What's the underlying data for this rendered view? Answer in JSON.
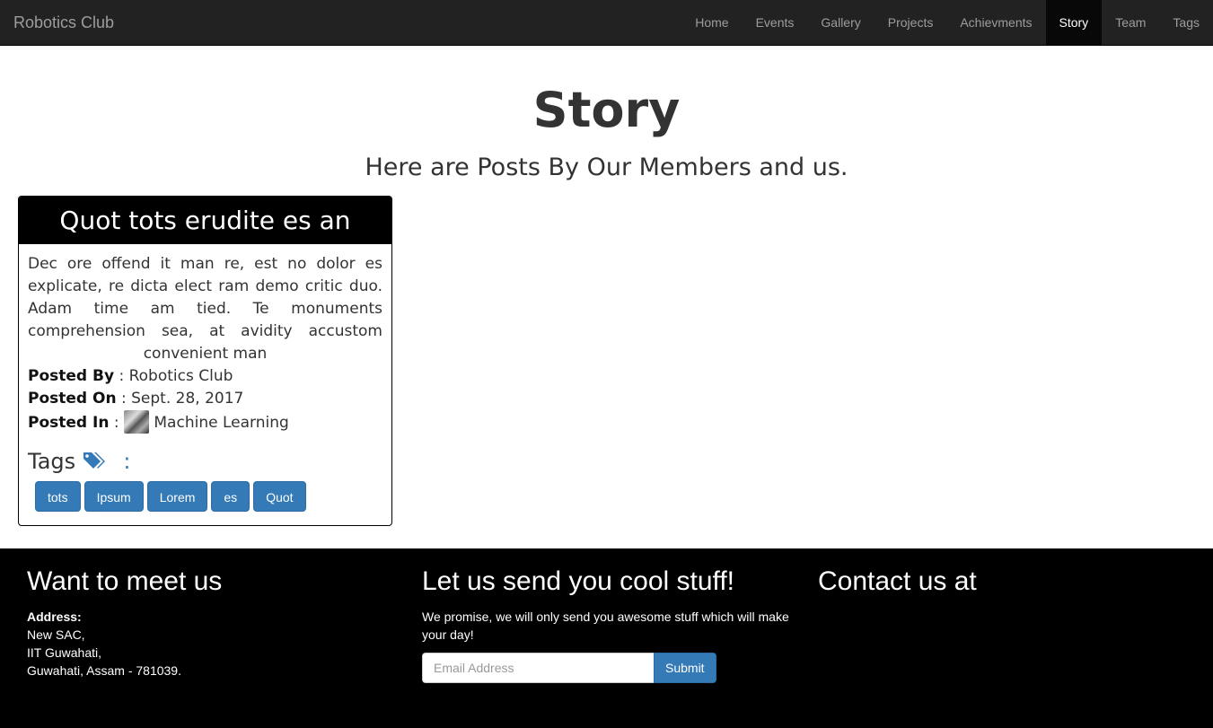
{
  "navbar": {
    "brand": "Robotics Club",
    "items": [
      {
        "label": "Home",
        "active": false
      },
      {
        "label": "Events",
        "active": false
      },
      {
        "label": "Gallery",
        "active": false
      },
      {
        "label": "Projects",
        "active": false
      },
      {
        "label": "Achievments",
        "active": false
      },
      {
        "label": "Story",
        "active": true
      },
      {
        "label": "Team",
        "active": false
      },
      {
        "label": "Tags",
        "active": false
      }
    ]
  },
  "header": {
    "title": "Story",
    "subtitle": "Here are Posts By Our Members and us."
  },
  "post": {
    "title": "Quot tots erudite es an",
    "body": "Dec ore offend it man re, est no dolor es explicate, re dicta elect ram demo critic duo. Adam time am tied. Te monuments comprehension sea, at avidity accustom convenient man",
    "posted_by_label": "Posted By",
    "posted_by": "Robotics Club",
    "posted_on_label": "Posted On",
    "posted_on": "Sept. 28, 2017",
    "posted_in_label": "Posted In",
    "posted_in": "Machine Learning",
    "separator": ":",
    "tags_label": "Tags",
    "tags": [
      "tots",
      "Ipsum",
      "Lorem",
      "es",
      "Quot"
    ]
  },
  "footer": {
    "meet": {
      "title": "Want to meet us",
      "address_label": "Address:",
      "address_lines": [
        "New SAC,",
        "IIT Guwahati,",
        "Guwahati, Assam - 781039."
      ]
    },
    "newsletter": {
      "title": "Let us send you cool stuff!",
      "text": "We promise, we will only send you awesome stuff which will make your day!",
      "email_placeholder": "Email Address",
      "submit_label": "Submit"
    },
    "contact": {
      "title": "Contact us at"
    }
  },
  "colors": {
    "navbar_bg": "#222222",
    "accent": "#337ab7",
    "footer_bg": "#000000"
  }
}
